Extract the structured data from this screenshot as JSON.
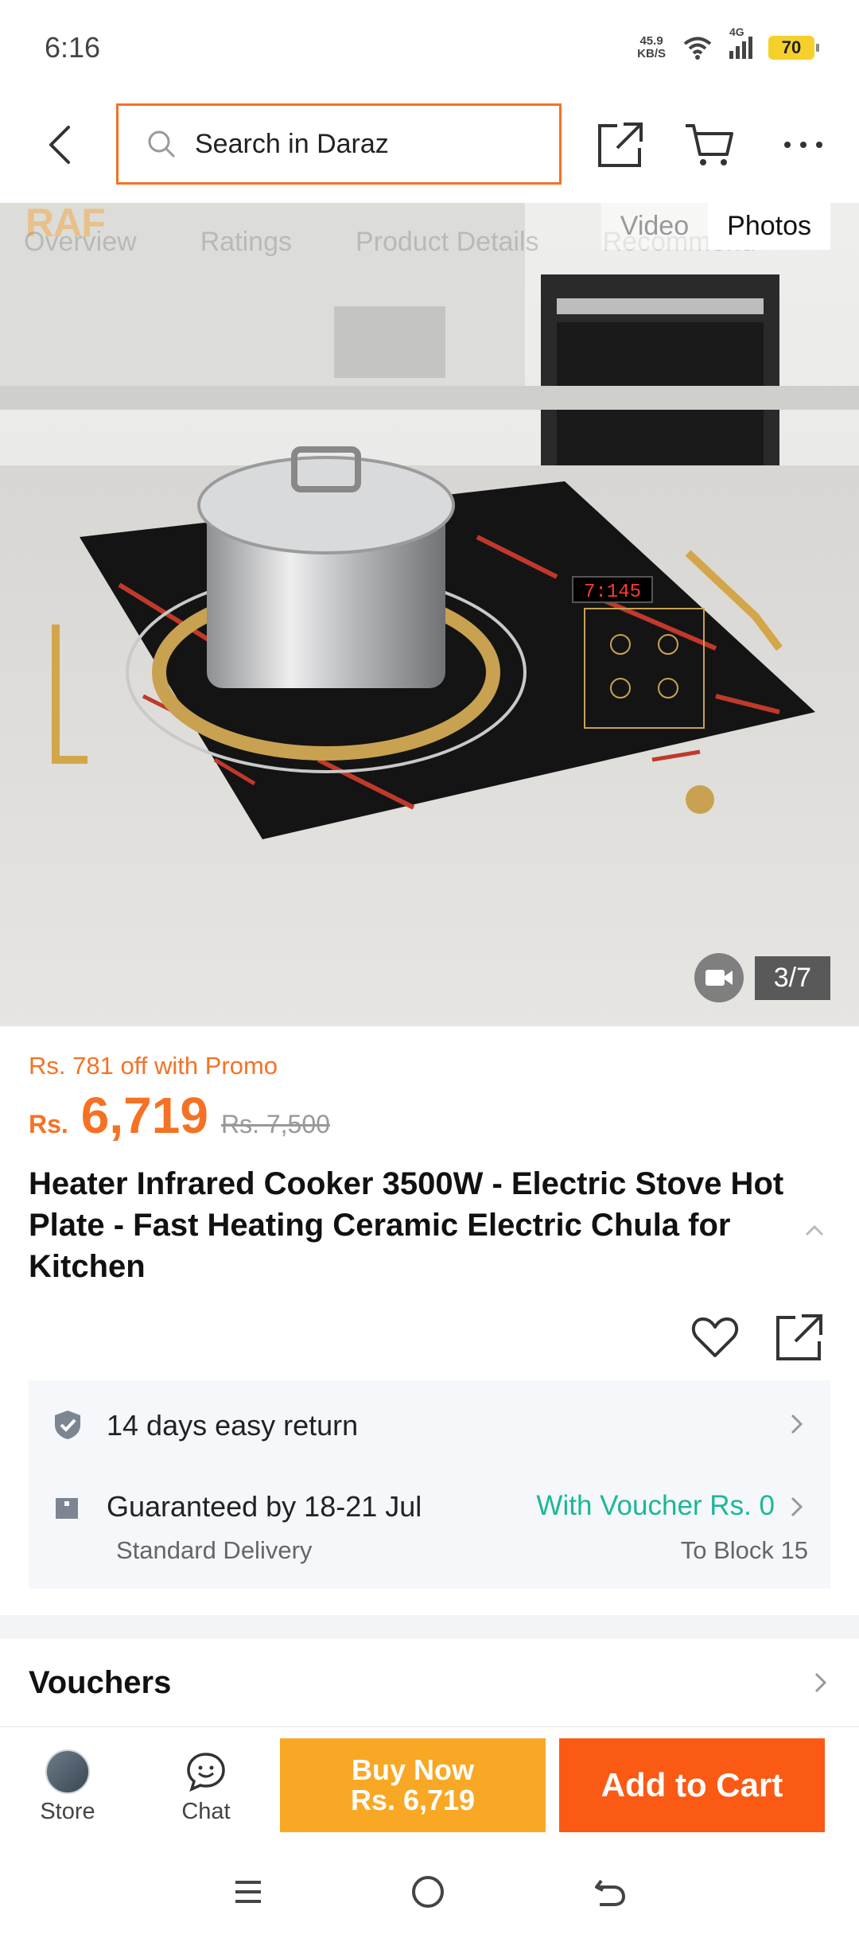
{
  "status_bar": {
    "time": "6:16",
    "net_speed_value": "45.9",
    "net_speed_unit": "KB/S",
    "network": "4G",
    "battery": "70"
  },
  "search": {
    "placeholder": "Search in Daraz"
  },
  "gallery": {
    "brand": "RAF",
    "media_tabs": [
      "Video",
      "Photos"
    ],
    "ghost_tabs": [
      "Overview",
      "Ratings",
      "Product Details",
      "Recommend"
    ],
    "page_counter": "3/7",
    "cooker_display": "7:145"
  },
  "product": {
    "promo": "Rs. 781 off with Promo",
    "currency": "Rs.",
    "price": "6,719",
    "old_price": "Rs. 7,500",
    "title": "Heater Infrared Cooker 3500W - Electric Stove Hot Plate - Fast Heating Ceramic Electric Chula for Kitchen"
  },
  "info": {
    "return_text": "14 days easy return",
    "delivery_text": "Guaranteed by 18-21 Jul",
    "delivery_type": "Standard Delivery",
    "voucher_text": "With Voucher Rs. 0",
    "location": "To Block 15"
  },
  "vouchers": {
    "label": "Vouchers"
  },
  "bottom_bar": {
    "store_label": "Store",
    "chat_label": "Chat",
    "buy_now_label": "Buy Now",
    "buy_now_price": "Rs. 6,719",
    "add_to_cart_label": "Add to Cart"
  },
  "colors": {
    "accent": "#f57224",
    "buy_now": "#f9a825",
    "add_to_cart": "#fa5a14",
    "voucher": "#1bb799"
  }
}
